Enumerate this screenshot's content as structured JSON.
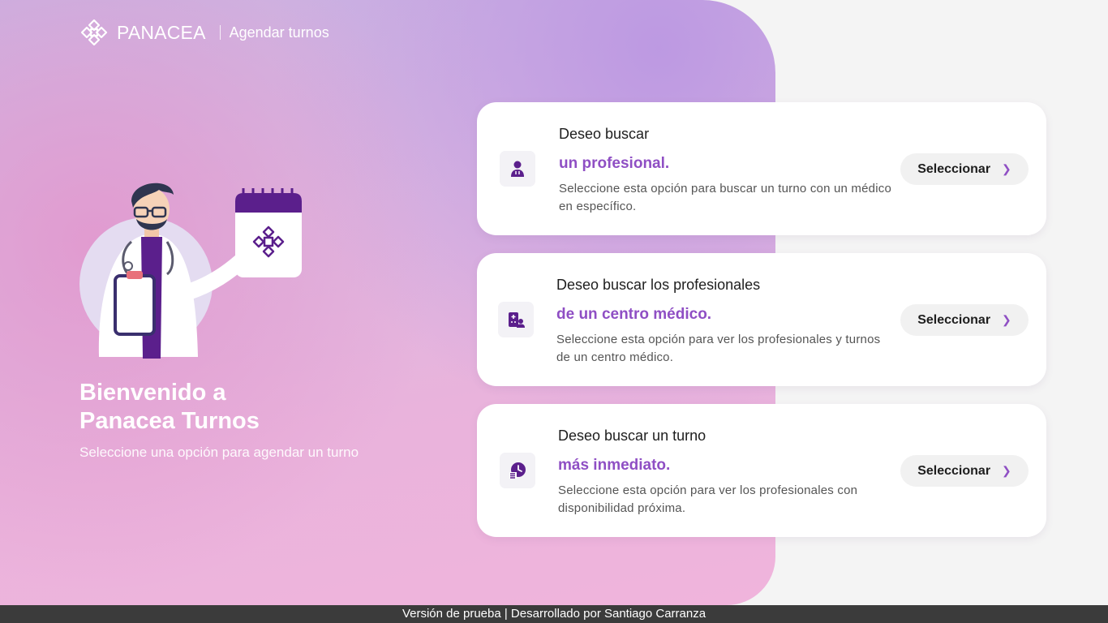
{
  "header": {
    "brand_name": "PANACEA",
    "subtitle": "Agendar turnos"
  },
  "welcome": {
    "title_line1": "Bienvenido a",
    "title_line2": "Panacea Turnos",
    "subtitle": "Seleccione una opción para agendar un turno"
  },
  "options": [
    {
      "heading": "Deseo buscar",
      "highlight": "un profesional.",
      "description": "Seleccione esta opción para buscar un turno con un médico en específico.",
      "button_label": "Seleccionar",
      "icon": "doctor-icon"
    },
    {
      "heading": "Deseo buscar los profesionales",
      "highlight": "de un centro médico.",
      "description": "Seleccione esta opción para ver los profesionales y turnos de un centro médico.",
      "button_label": "Seleccionar",
      "icon": "medical-center-icon"
    },
    {
      "heading": "Deseo buscar un turno",
      "highlight": "más inmediato.",
      "description": "Seleccione esta opción para ver los profesionales con disponibilidad próxima.",
      "button_label": "Seleccionar",
      "icon": "clock-list-icon"
    }
  ],
  "footer": {
    "text": "Versión de prueba | Desarrollado por Santiago Carranza"
  },
  "colors": {
    "accent": "#8f4fc4",
    "icon": "#5b1f8c",
    "footer_bg": "#3b3b3b"
  }
}
